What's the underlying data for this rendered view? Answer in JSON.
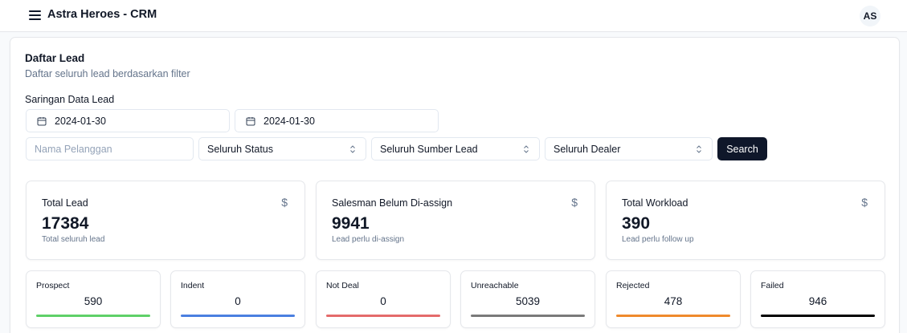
{
  "header": {
    "menu_icon": "hamburger-icon",
    "title": "Astra Heroes - CRM",
    "avatar_initials": "AS"
  },
  "page": {
    "title": "Daftar Lead",
    "subtitle": "Daftar seluruh lead berdasarkan filter"
  },
  "filters": {
    "section_title": "Saringan Data Lead",
    "date_from": "2024-01-30",
    "date_to": "2024-01-30",
    "calendar_icon": "calendar-icon",
    "customer_name": {
      "value": "",
      "placeholder": "Nama Pelanggan"
    },
    "status_select": "Seluruh Status",
    "source_select": "Seluruh Sumber Lead",
    "dealer_select": "Seluruh Dealer",
    "select_icon": "chevron-updown-icon",
    "search_label": "Search"
  },
  "stats": [
    {
      "title": "Total Lead",
      "value": "17384",
      "note": "Total seluruh lead",
      "icon": "dollar-icon",
      "icon_glyph": "$"
    },
    {
      "title": "Salesman Belum Di-assign",
      "value": "9941",
      "note": "Lead perlu di-assign",
      "icon": "dollar-icon",
      "icon_glyph": "$"
    },
    {
      "title": "Total Workload",
      "value": "390",
      "note": "Lead perlu follow up",
      "icon": "dollar-icon",
      "icon_glyph": "$"
    }
  ],
  "statuses": [
    {
      "label": "Prospect",
      "value": "590",
      "color": "#5fd068"
    },
    {
      "label": "Indent",
      "value": "0",
      "color": "#4a7fe0"
    },
    {
      "label": "Not Deal",
      "value": "0",
      "color": "#e46b6b"
    },
    {
      "label": "Unreachable",
      "value": "5039",
      "color": "#7a7a7a"
    },
    {
      "label": "Rejected",
      "value": "478",
      "color": "#ef8a2c"
    },
    {
      "label": "Failed",
      "value": "946",
      "color": "#000000"
    }
  ]
}
